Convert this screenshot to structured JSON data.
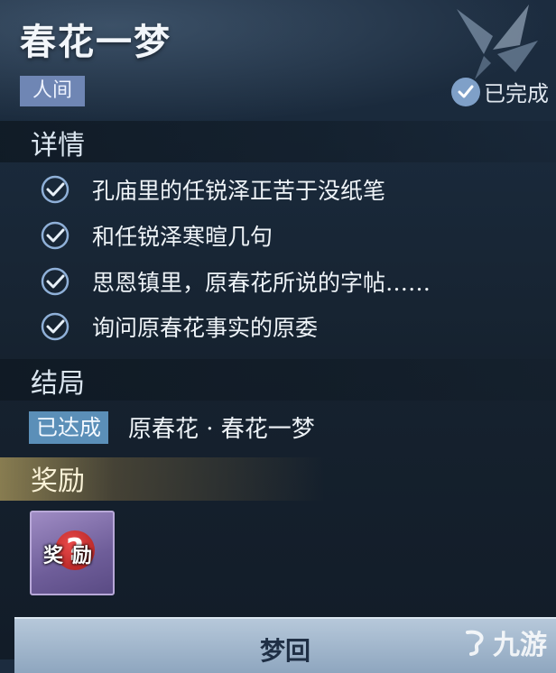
{
  "quest": {
    "title": "春花一梦",
    "world_tag": "人间",
    "status_label": "已完成"
  },
  "details": {
    "heading": "详情",
    "tasks": [
      {
        "text": "孔庙里的任锐泽正苦于没纸笔",
        "done": true
      },
      {
        "text": "和任锐泽寒暄几句",
        "done": true
      },
      {
        "text": "思恩镇里，原春花所说的字帖……",
        "done": true
      },
      {
        "text": "询问原春花事实的原委",
        "done": true
      }
    ]
  },
  "ending": {
    "heading": "结局",
    "badge": "已达成",
    "text": "原春花 · 春花一梦"
  },
  "reward": {
    "heading": "奖励",
    "item_label": "奖励"
  },
  "actions": {
    "dream_button": "梦回"
  },
  "watermark": {
    "text": "九游"
  },
  "colors": {
    "world_tag_bg": "#6f86b4",
    "badge_bg": "#5b8fb8",
    "check_color": "#8fb0d8",
    "reward_gold": "#e6c86e"
  }
}
